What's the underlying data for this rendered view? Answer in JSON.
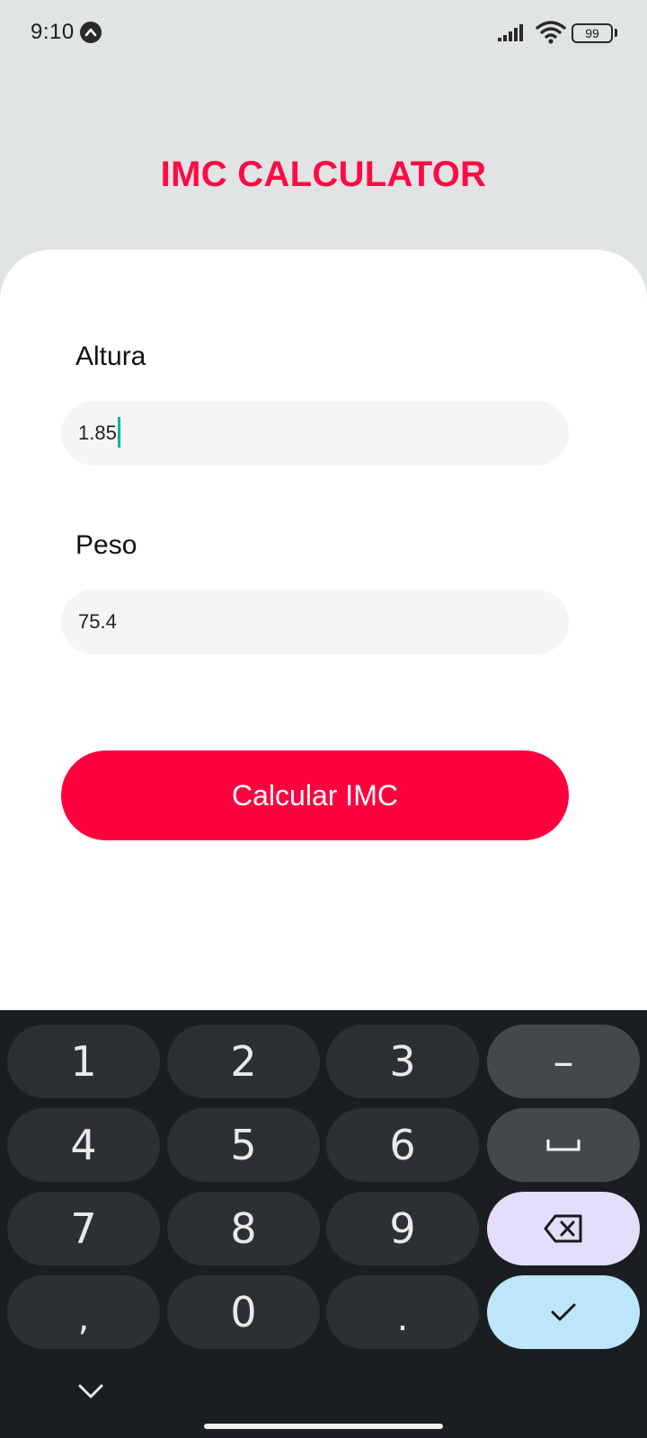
{
  "status_bar": {
    "time": "9:10",
    "battery": "99"
  },
  "app": {
    "title": "IMC CALCULATOR",
    "title_color": "#ff0a44",
    "accent_color": "#ff003f"
  },
  "form": {
    "height": {
      "label": "Altura",
      "value": "1.85"
    },
    "weight": {
      "label": "Peso",
      "value": "75.4"
    },
    "submit_label": "Calcular IMC"
  },
  "keyboard": {
    "keys": {
      "k1": "1",
      "k2": "2",
      "k3": "3",
      "minus": "–",
      "k4": "4",
      "k5": "5",
      "k6": "6",
      "k7": "7",
      "k8": "8",
      "k9": "9",
      "comma": ",",
      "k0": "0",
      "dot": "."
    },
    "icons": {
      "space": "space-icon",
      "delete": "backspace-icon",
      "done": "check-icon",
      "hide": "chevron-down-icon"
    }
  }
}
